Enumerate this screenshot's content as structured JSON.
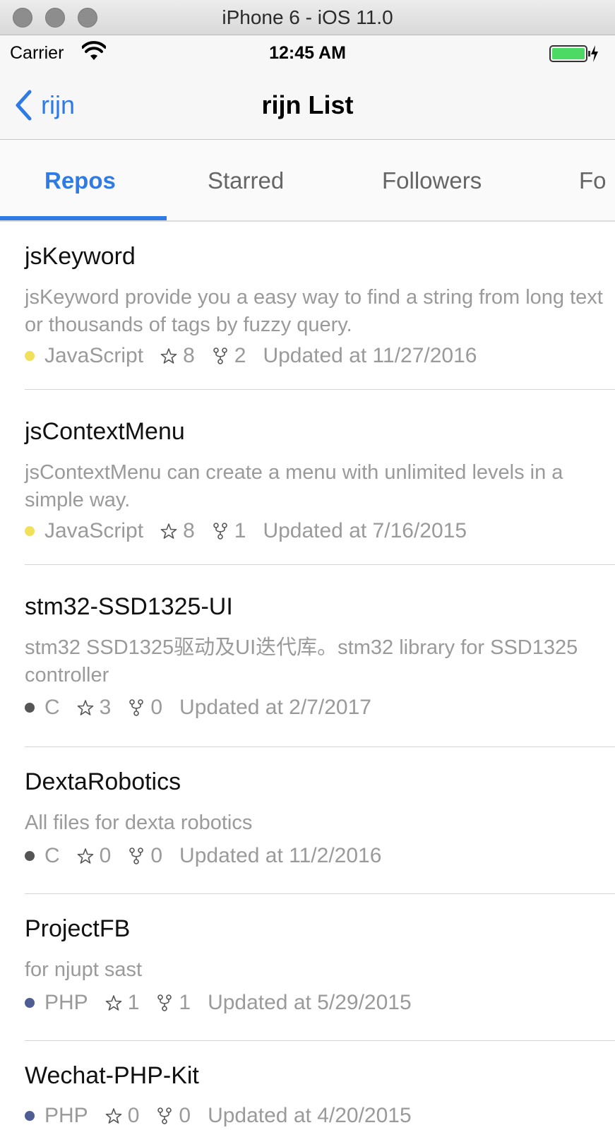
{
  "window": {
    "title": "iPhone 6 - iOS 11.0"
  },
  "status_bar": {
    "carrier": "Carrier",
    "time": "12:45 AM",
    "battery_color": "#4cd964"
  },
  "nav": {
    "back_label": "rijn",
    "title": "rijn List"
  },
  "tabs": [
    {
      "label": "Repos",
      "active": true
    },
    {
      "label": "Starred",
      "active": false
    },
    {
      "label": "Followers",
      "active": false
    },
    {
      "label": "Fo",
      "active": false
    }
  ],
  "accent_color": "#2f7be5",
  "repos": [
    {
      "name": "jsKeyword",
      "description": "jsKeyword provide you a easy way to find a string from long text or thousands of tags by fuzzy query.",
      "language": "JavaScript",
      "language_color": "#f1e05a",
      "stars": "8",
      "forks": "2",
      "updated": "Updated at 11/27/2016"
    },
    {
      "name": "jsContextMenu",
      "description": "jsContextMenu can create a menu with unlimited levels in a simple way.",
      "language": "JavaScript",
      "language_color": "#f1e05a",
      "stars": "8",
      "forks": "1",
      "updated": "Updated at 7/16/2015"
    },
    {
      "name": "stm32-SSD1325-UI",
      "description": "stm32 SSD1325驱动及UI迭代库。stm32 library for SSD1325 controller",
      "language": "C",
      "language_color": "#555555",
      "stars": "3",
      "forks": "0",
      "updated": "Updated at 2/7/2017"
    },
    {
      "name": "DextaRobotics",
      "description": "All files for dexta robotics",
      "language": "C",
      "language_color": "#555555",
      "stars": "0",
      "forks": "0",
      "updated": "Updated at 11/2/2016"
    },
    {
      "name": "ProjectFB",
      "description": "for njupt sast",
      "language": "PHP",
      "language_color": "#4f5d95",
      "stars": "1",
      "forks": "1",
      "updated": "Updated at 5/29/2015"
    },
    {
      "name": "Wechat-PHP-Kit",
      "description": "",
      "language": "PHP",
      "language_color": "#4f5d95",
      "stars": "0",
      "forks": "0",
      "updated": "Updated at 4/20/2015"
    }
  ]
}
